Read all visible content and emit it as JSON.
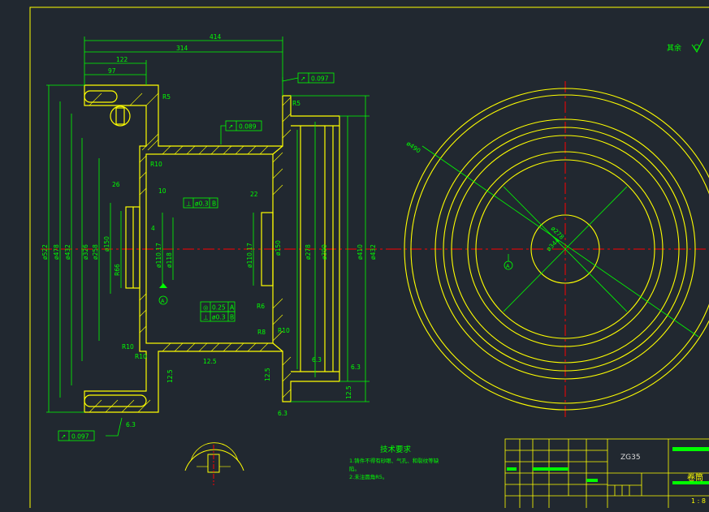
{
  "colors": {
    "background": "#212830",
    "outline": "#ffff00",
    "dimension": "#00ff00",
    "center_line": "#ff0000",
    "text_light": "#dcdcdc"
  },
  "dimensions": {
    "top": [
      "414",
      "314",
      "122",
      "97"
    ],
    "left_diameters": [
      "ø522",
      "ø478",
      "ø432",
      "ø326",
      "ø258",
      "ø150",
      "R66"
    ],
    "right_diameters": [
      "ø278",
      "ø390",
      "ø410",
      "ø432"
    ],
    "hub": [
      "ø110.17",
      "ø118",
      "ø150",
      "ø110.17",
      "22",
      "10",
      "26",
      "4"
    ],
    "radii": [
      "R10",
      "R10",
      "R10",
      "R6",
      "R10",
      "R8",
      "R5",
      "R5"
    ],
    "circle_view": [
      "ø490",
      "ø278",
      "ø344"
    ],
    "roughness": [
      "12.5",
      "12.5",
      "6.3",
      "6.3",
      "6.3",
      "6.3",
      "12.5",
      "12.5"
    ]
  },
  "tolerance_frames": [
    {
      "symbol": "↗",
      "value": "0.097"
    },
    {
      "symbol": "↗",
      "value": "0.089"
    },
    {
      "symbol": "⊥",
      "value": "ø0.3",
      "datum": "B"
    },
    {
      "symbol": "◎",
      "value": "0.25",
      "datum": "A"
    },
    {
      "symbol": "⊥",
      "value": "ø0.3",
      "datum": "B"
    },
    {
      "symbol": "↗",
      "value": "0.097"
    }
  ],
  "datum_labels": [
    "A",
    "A"
  ],
  "surface_note": "其余",
  "tech_requirements": {
    "title": "技术要求",
    "line1": "1.铸件不得有砂眼、气孔、和裂纹等缺",
    "line1b": "陷。",
    "line2": "2.未注圆角R5。"
  },
  "title_block": {
    "material": "ZG35",
    "part_name": "卷筒",
    "scale": "1 : 8"
  }
}
